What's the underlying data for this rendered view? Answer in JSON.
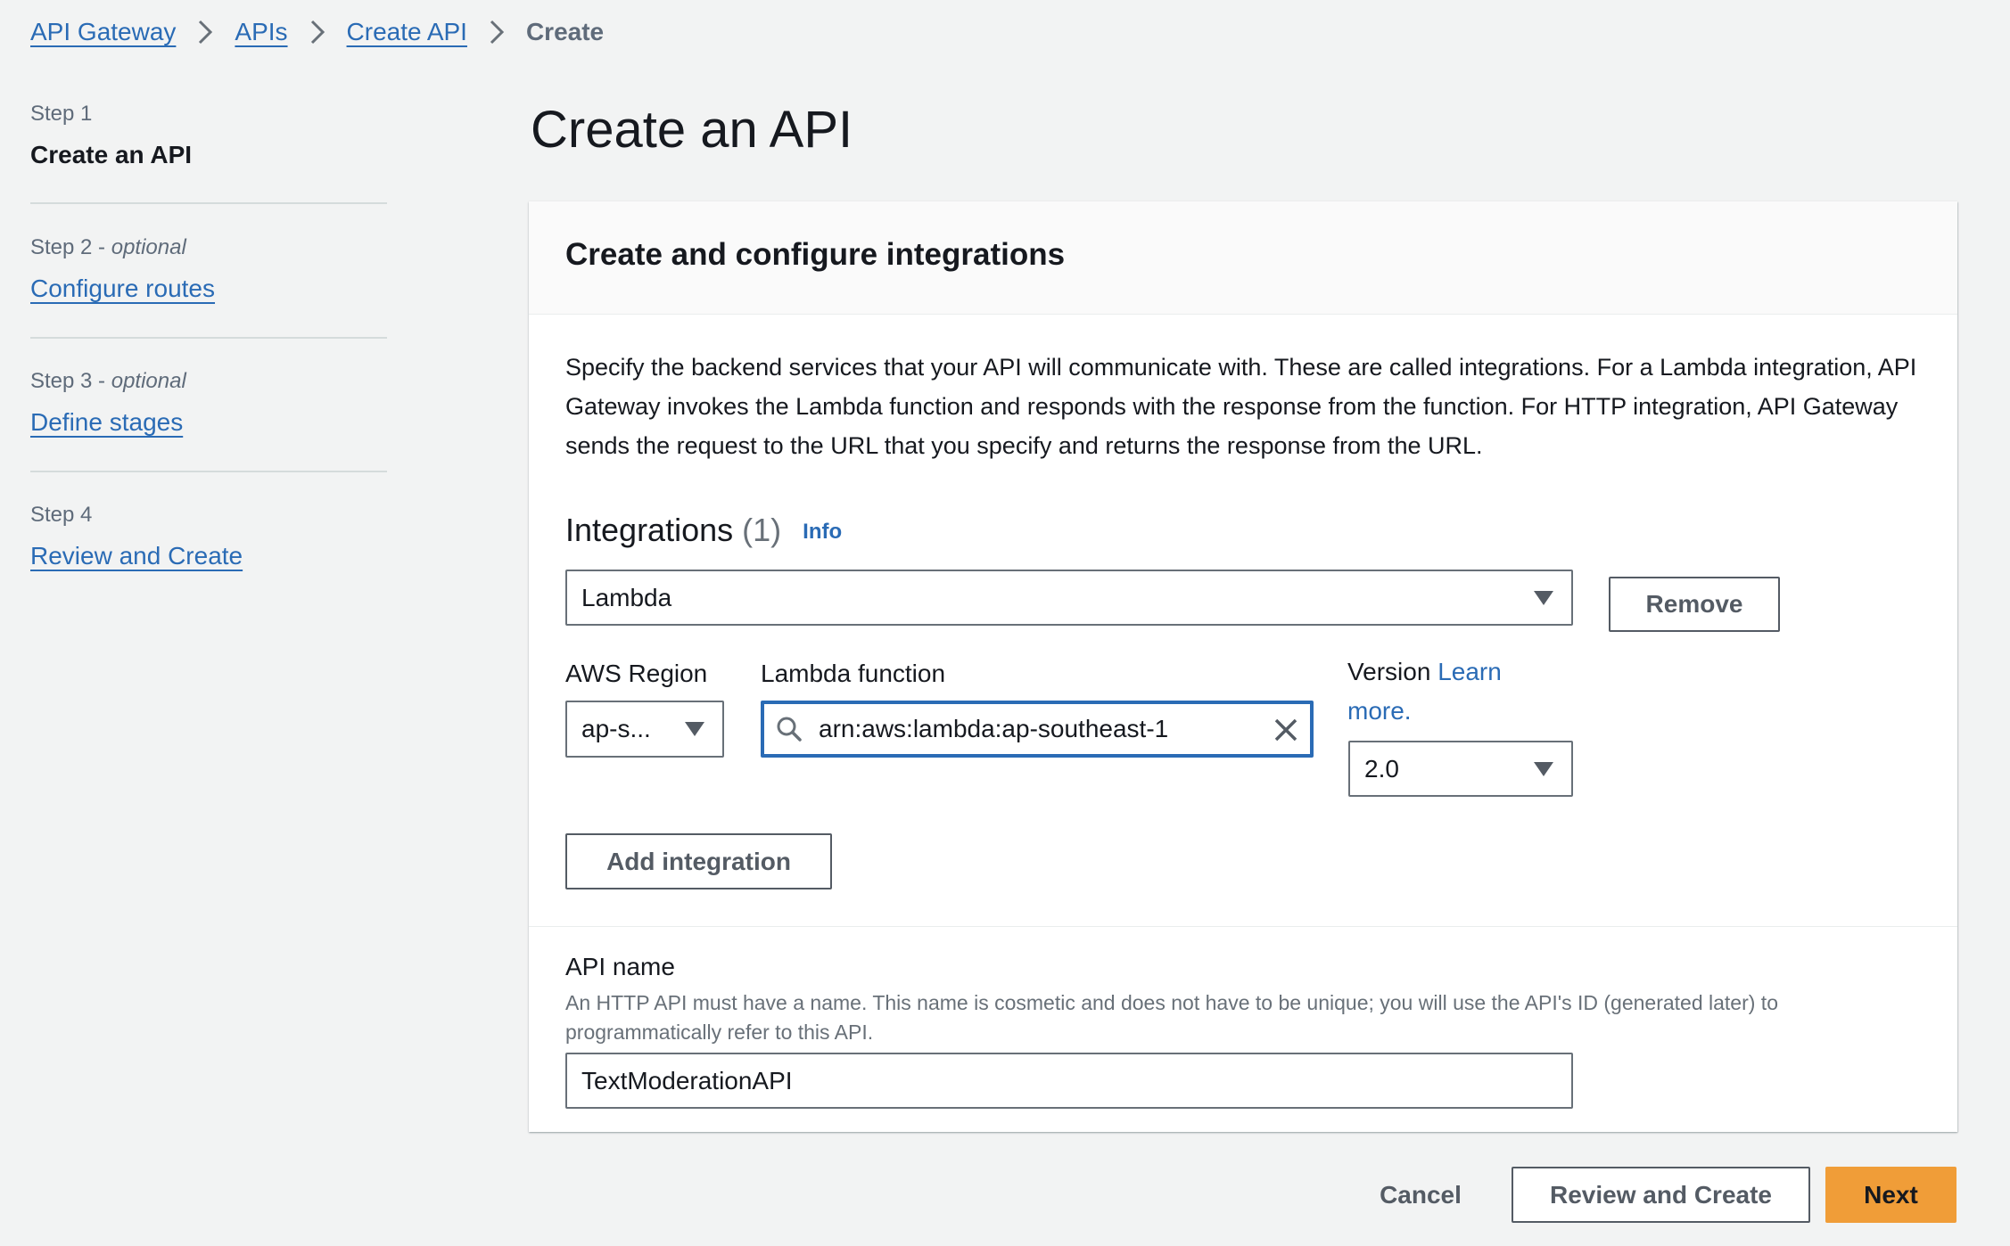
{
  "breadcrumb": {
    "items": [
      {
        "label": "API Gateway",
        "link": true
      },
      {
        "label": "APIs",
        "link": true
      },
      {
        "label": "Create API",
        "link": true
      },
      {
        "label": "Create",
        "link": false
      }
    ],
    "separator_icon": "chevron-right-icon"
  },
  "wizard_steps": [
    {
      "step": "Step 1",
      "optional": "",
      "title": "Create an API",
      "current": true
    },
    {
      "step": "Step 2",
      "optional": "optional",
      "title": "Configure routes",
      "current": false
    },
    {
      "step": "Step 3",
      "optional": "optional",
      "title": "Define stages",
      "current": false
    },
    {
      "step": "Step 4",
      "optional": "",
      "title": "Review and Create",
      "current": false
    }
  ],
  "optional_prefix": " - ",
  "page_title": "Create an API",
  "card": {
    "title": "Create and configure integrations",
    "description": "Specify the backend services that your API will communicate with. These are called integrations. For a Lambda integration, API Gateway invokes the Lambda function and responds with the response from the function. For HTTP integration, API Gateway sends the request to the URL that you specify and returns the response from the URL.",
    "integrations": {
      "heading": "Integrations",
      "count": "(1)",
      "info_label": "Info",
      "type_select": {
        "value": "Lambda"
      },
      "remove_label": "Remove",
      "region": {
        "label": "AWS Region",
        "value": "ap-s..."
      },
      "lambda_function": {
        "label": "Lambda function",
        "value": "arn:aws:lambda:ap-southeast-1"
      },
      "version": {
        "label": "Version",
        "learn_more": "Learn more.",
        "value": "2.0"
      },
      "add_label": "Add integration"
    },
    "api_name": {
      "label": "API name",
      "description": "An HTTP API must have a name. This name is cosmetic and does not have to be unique; you will use the API's ID (generated later) to programmatically refer to this API.",
      "value": "TextModerationAPI"
    }
  },
  "footer": {
    "cancel_label": "Cancel",
    "review_label": "Review and Create",
    "next_label": "Next"
  },
  "colors": {
    "link": "#2a6bb5",
    "primary": "#f09d38",
    "background": "#f2f3f3"
  }
}
